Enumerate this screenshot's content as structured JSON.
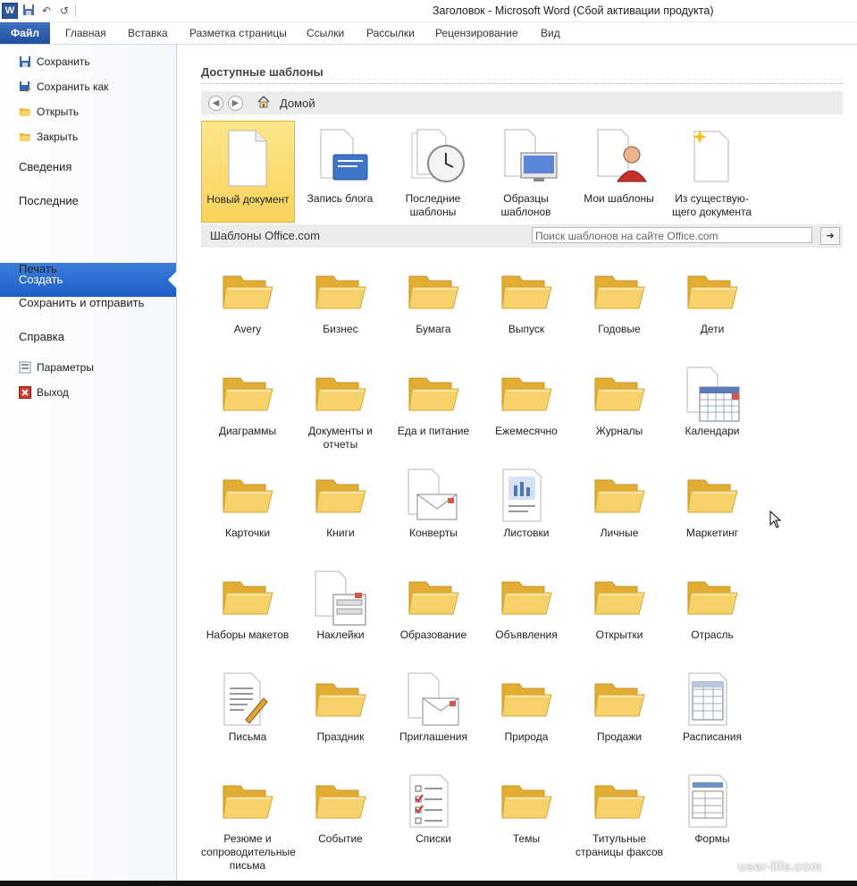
{
  "window": {
    "title": "Заголовок  -  Microsoft Word (Сбой активации продукта)"
  },
  "ribbon": {
    "file_tab": "Файл",
    "tabs": [
      "Главная",
      "Вставка",
      "Разметка страницы",
      "Ссылки",
      "Рассылки",
      "Рецензирование",
      "Вид"
    ]
  },
  "leftnav": {
    "save": "Сохранить",
    "save_as": "Сохранить как",
    "open": "Открыть",
    "close": "Закрыть",
    "info": "Сведения",
    "recent": "Последние",
    "new": "Создать",
    "print": "Печать",
    "save_send": "Сохранить и отправить",
    "help": "Справка",
    "options": "Параметры",
    "exit": "Выход"
  },
  "main": {
    "heading": "Доступные шаблоны",
    "home": "Домой",
    "templates": [
      "Новый документ",
      "Запись блога",
      "Последние шаблоны",
      "Образцы шаблонов",
      "Мои шаблоны",
      "Из существую-щего документа"
    ],
    "office_title": "Шаблоны Office.com",
    "search_placeholder": "Поиск шаблонов на сайте Office.com",
    "categories": [
      {
        "label": "Avery",
        "icon": "folder-icon"
      },
      {
        "label": "Бизнес",
        "icon": "folder-icon"
      },
      {
        "label": "Бумага",
        "icon": "folder-icon"
      },
      {
        "label": "Выпуск",
        "icon": "folder-icon"
      },
      {
        "label": "Годовые",
        "icon": "folder-icon"
      },
      {
        "label": "Дети",
        "icon": "folder-icon"
      },
      {
        "label": "Диаграммы",
        "icon": "folder-icon"
      },
      {
        "label": "Документы и отчеты",
        "icon": "folder-icon"
      },
      {
        "label": "Еда и питание",
        "icon": "folder-icon"
      },
      {
        "label": "Ежемесячно",
        "icon": "folder-icon"
      },
      {
        "label": "Журналы",
        "icon": "folder-icon"
      },
      {
        "label": "Календари",
        "icon": "calendar-icon"
      },
      {
        "label": "Карточки",
        "icon": "folder-icon"
      },
      {
        "label": "Книги",
        "icon": "folder-icon"
      },
      {
        "label": "Конверты",
        "icon": "envelope-icon"
      },
      {
        "label": "Листовки",
        "icon": "flyer-icon"
      },
      {
        "label": "Личные",
        "icon": "folder-icon"
      },
      {
        "label": "Маркетинг",
        "icon": "folder-icon"
      },
      {
        "label": "Наборы макетов",
        "icon": "folder-icon"
      },
      {
        "label": "Наклейки",
        "icon": "labels-icon"
      },
      {
        "label": "Образование",
        "icon": "folder-icon"
      },
      {
        "label": "Объявления",
        "icon": "folder-icon"
      },
      {
        "label": "Открытки",
        "icon": "folder-icon"
      },
      {
        "label": "Отрасль",
        "icon": "folder-icon"
      },
      {
        "label": "Письма",
        "icon": "letter-icon"
      },
      {
        "label": "Праздник",
        "icon": "folder-icon"
      },
      {
        "label": "Приглашения",
        "icon": "invitation-icon"
      },
      {
        "label": "Природа",
        "icon": "folder-icon"
      },
      {
        "label": "Продажи",
        "icon": "folder-icon"
      },
      {
        "label": "Расписания",
        "icon": "schedule-icon"
      },
      {
        "label": "Резюме и сопроводительные письма",
        "icon": "folder-icon"
      },
      {
        "label": "Событие",
        "icon": "folder-icon"
      },
      {
        "label": "Списки",
        "icon": "list-icon"
      },
      {
        "label": "Темы",
        "icon": "folder-icon"
      },
      {
        "label": "Титульные страницы факсов",
        "icon": "folder-icon"
      },
      {
        "label": "Формы",
        "icon": "form-icon"
      }
    ]
  },
  "watermark": "user-life.com",
  "colors": {
    "accent": "#1f5fc5",
    "selected_tile": "#fbd35c",
    "folder": "#f5c94a"
  }
}
